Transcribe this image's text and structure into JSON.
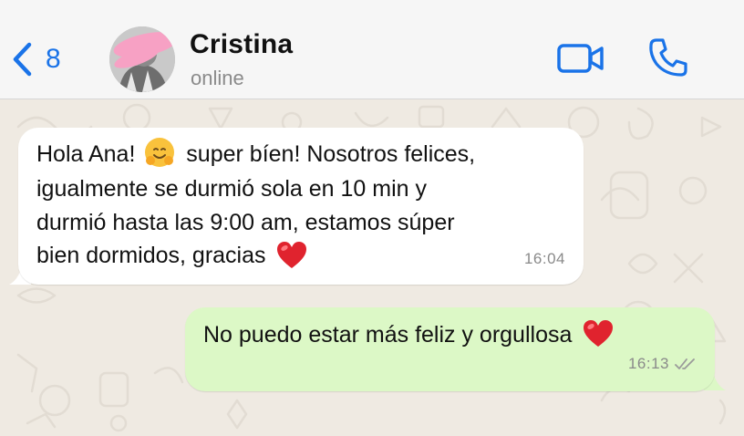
{
  "header": {
    "back_count": "8",
    "contact_name": "Cristina",
    "contact_status": "online",
    "accent_color": "#1a73e8"
  },
  "icons": {
    "back": "chevron-left-icon",
    "video": "video-camera-icon",
    "call": "phone-icon",
    "read_receipt": "double-check-icon"
  },
  "messages": [
    {
      "direction": "incoming",
      "lines": [
        "Hola Ana! ",
        " super bíen! Nosotros felices,",
        "igualmente se durmió sola en 10 min y",
        "durmió hasta las 9:00 am, estamos súper",
        "bien dormidos, gracias "
      ],
      "emojis": [
        "hugging-face",
        "red-heart"
      ],
      "time": "16:04",
      "bubble_color": "#ffffff"
    },
    {
      "direction": "outgoing",
      "text": "No puedo estar más feliz y orgullosa ",
      "emojis": [
        "red-heart"
      ],
      "time": "16:13",
      "status": "read",
      "bubble_color": "#dcf8c6"
    }
  ],
  "chat_background_color": "#efeae2"
}
